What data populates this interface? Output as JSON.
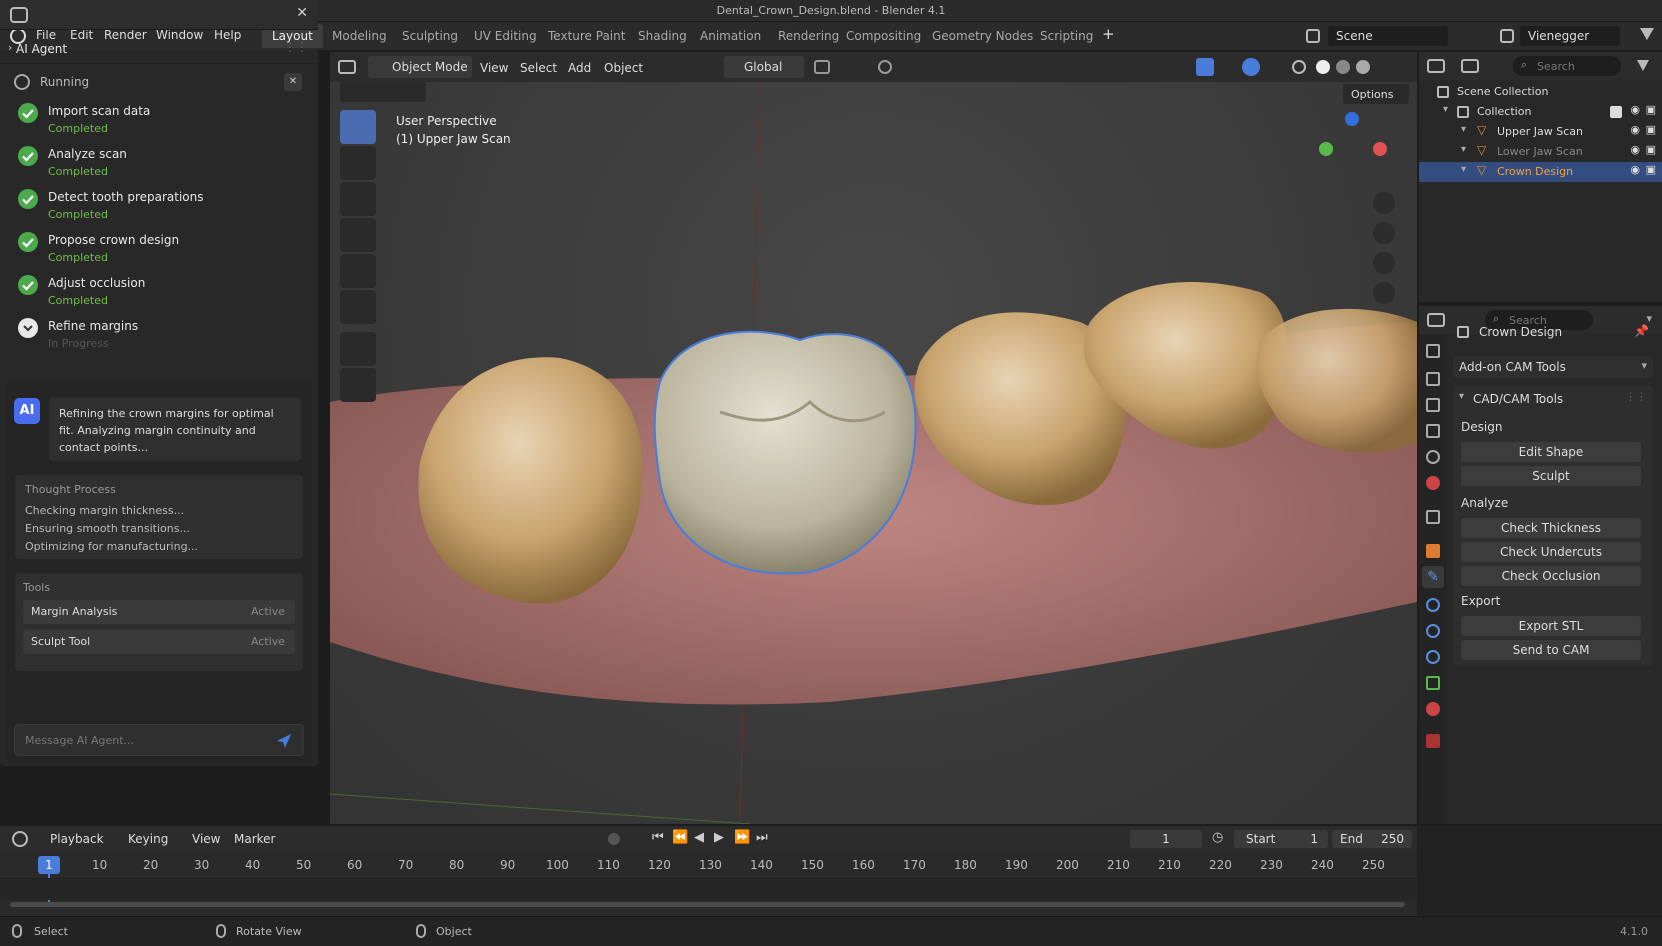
{
  "window": {
    "title": "Dental_Crown_Design.blend - Blender 4.1"
  },
  "menu": {
    "items": [
      "File",
      "Edit",
      "Render",
      "Window",
      "Help"
    ]
  },
  "workspaces": [
    "Layout",
    "Modeling",
    "Sculpting",
    "UV Editing",
    "Texture Paint",
    "Shading",
    "Animation",
    "Rendering",
    "Compositing",
    "Geometry Nodes",
    "Scripting"
  ],
  "top_right": {
    "scene": "Scene",
    "view_layer": "Vienegger"
  },
  "agent": {
    "title": "AI Agent",
    "status": "Running",
    "steps": [
      {
        "label": "Import scan data",
        "status": "Completed"
      },
      {
        "label": "Analyze scan",
        "status": "Completed"
      },
      {
        "label": "Detect tooth preparations",
        "status": "Completed"
      },
      {
        "label": "Propose crown design",
        "status": "Completed"
      },
      {
        "label": "Adjust occlusion",
        "status": "Completed"
      },
      {
        "label": "Refine margins",
        "status": "In Progress"
      }
    ],
    "avatar": "AI",
    "message": "Refining the crown margins for optimal fit. Analyzing margin continuity and contact points...",
    "thought_title": "Thought Process",
    "thoughts": [
      "Checking margin thickness...",
      "Ensuring smooth transitions...",
      "Optimizing for manufacturing..."
    ],
    "tools_title": "Tools",
    "tools": [
      {
        "name": "Margin Analysis",
        "status": "Active"
      },
      {
        "name": "Sculpt Tool",
        "status": "Active"
      }
    ],
    "input_placeholder": "Message AI Agent..."
  },
  "viewport": {
    "mode": "Object Mode",
    "menus": [
      "View",
      "Select",
      "Add",
      "Object"
    ],
    "orientation": "Global",
    "options": "Options",
    "overlay_line1": "User Perspective",
    "overlay_line2": "(1) Upper Jaw Scan"
  },
  "outliner": {
    "search_placeholder": "Search",
    "root": "Scene Collection",
    "collection": "Collection",
    "items": [
      "Upper Jaw Scan",
      "Lower Jaw Scan",
      "Crown Design"
    ]
  },
  "properties": {
    "search_placeholder": "Search",
    "object_name": "Crown Design",
    "addon_dropdown": "Add-on CAM Tools",
    "panel_title": "CAD/CAM Tools",
    "design_label": "Design",
    "design_buttons": [
      "Edit Shape",
      "Sculpt"
    ],
    "analyze_label": "Analyze",
    "analyze_buttons": [
      "Check Thickness",
      "Check Undercuts",
      "Check Occlusion"
    ],
    "export_label": "Export",
    "export_buttons": [
      "Export STL",
      "Send to CAM"
    ]
  },
  "timeline": {
    "menus": [
      "Playback",
      "Keying",
      "View",
      "Marker"
    ],
    "current_frame": "1",
    "start_label": "Start",
    "start": "1",
    "end_label": "End",
    "end": "250",
    "ticks": [
      "1",
      "10",
      "20",
      "30",
      "40",
      "50",
      "60",
      "70",
      "80",
      "90",
      "100",
      "110",
      "120",
      "130",
      "140",
      "150",
      "160",
      "170",
      "180",
      "190",
      "200",
      "210",
      "210",
      "220",
      "230",
      "240",
      "250"
    ]
  },
  "statusbar": {
    "select": "Select",
    "rotate": "Rotate View",
    "object": "Object",
    "version": "4.1.0"
  },
  "colors": {
    "accent_blue": "#4a7cdc",
    "success_green": "#4caa4c",
    "selection_orange": "#f0a040"
  }
}
